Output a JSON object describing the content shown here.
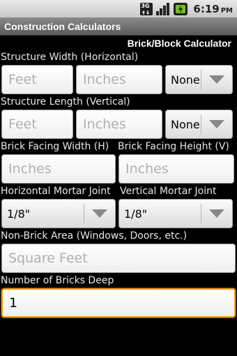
{
  "status_bar": {
    "network_label": "3G",
    "time": "6:19",
    "ampm": "PM",
    "icons": [
      "network-3g-icon",
      "signal-strength-icon",
      "battery-charging-icon"
    ],
    "battery_color": "#74c01b"
  },
  "app": {
    "title": "Construction Calculators",
    "section_title": "Brick/Block Calculator"
  },
  "form": {
    "structure_width": {
      "label": "Structure Width (Horizontal)",
      "feet_placeholder": "Feet",
      "inches_placeholder": "Inches",
      "fraction_value": "None"
    },
    "structure_length": {
      "label": "Structure Length (Vertical)",
      "feet_placeholder": "Feet",
      "inches_placeholder": "Inches",
      "fraction_value": "None"
    },
    "brick_facing_width": {
      "label": "Brick Facing Width (H)",
      "placeholder": "Inches"
    },
    "brick_facing_height": {
      "label": "Brick Facing Height (V)",
      "placeholder": "Inches"
    },
    "horizontal_mortar_joint": {
      "label": "Horizontal Mortar Joint",
      "value": "1/8\""
    },
    "vertical_mortar_joint": {
      "label": "Vertical Mortar Joint",
      "value": "1/8\""
    },
    "non_brick_area": {
      "label": "Non-Brick Area (Windows, Doors, etc.)",
      "placeholder": "Square Feet"
    },
    "bricks_deep": {
      "label": "Number of Bricks Deep",
      "value": "1"
    }
  }
}
